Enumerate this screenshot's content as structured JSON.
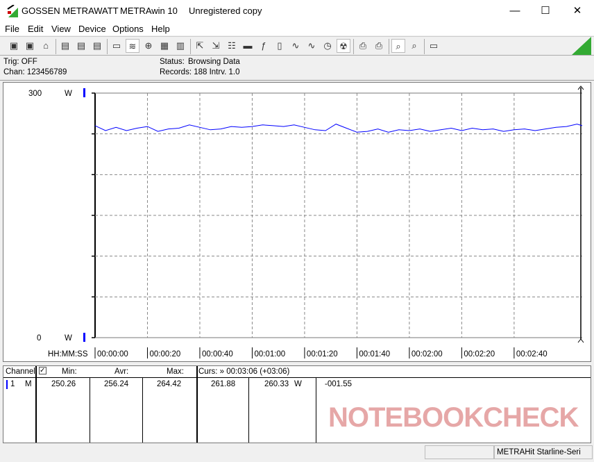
{
  "window": {
    "brand": "GOSSEN METRAWATT",
    "app": "METRAwin 10",
    "license": "Unregistered copy",
    "minimize": "—",
    "maximize": "☐",
    "close": "✕"
  },
  "menu": [
    "File",
    "Edit",
    "View",
    "Device",
    "Options",
    "Help"
  ],
  "toolbar_icons": [
    "save-icon",
    "save-as-icon",
    "open-icon",
    "device-read-icon",
    "device-stop-icon",
    "device-memory-icon",
    "display-icon",
    "wave-view-icon",
    "crosshair-icon",
    "table-icon",
    "histogram-icon",
    "export-icon",
    "import-icon",
    "data-list-icon",
    "monitor-icon",
    "formula-icon",
    "meter-icon",
    "signal-icon",
    "multi-signal-icon",
    "clock-icon",
    "trigger-icon",
    "print-icon",
    "print-setup-icon",
    "zoom-wave-icon",
    "zoom-icon",
    "comment-icon"
  ],
  "info": {
    "trig": "Trig: OFF",
    "chan": "Chan:  123456789",
    "status_label": "Status:",
    "status_value": "Browsing Data",
    "records": "Records: 188  Intrv. 1.0"
  },
  "chart_data": {
    "type": "line",
    "xlabel": "HH:MM:SS",
    "ylabel": "W",
    "ylim": [
      0,
      300
    ],
    "yticks": [
      "300",
      "0"
    ],
    "xlim": [
      0,
      186
    ],
    "xticks": [
      "00:00:00",
      "00:00:20",
      "00:00:40",
      "00:01:00",
      "00:01:20",
      "00:01:40",
      "00:02:00",
      "00:02:20",
      "00:02:40"
    ],
    "grid": true,
    "color": "#0000ff",
    "x": [
      0,
      4,
      8,
      12,
      16,
      20,
      24,
      28,
      32,
      36,
      40,
      44,
      48,
      52,
      56,
      60,
      64,
      68,
      72,
      76,
      80,
      84,
      88,
      92,
      96,
      100,
      104,
      108,
      112,
      116,
      120,
      124,
      128,
      132,
      136,
      140,
      144,
      148,
      152,
      156,
      160,
      164,
      168,
      172,
      176,
      180,
      184,
      186
    ],
    "values": [
      260,
      254,
      258,
      254,
      257,
      259,
      253,
      256,
      257,
      261,
      258,
      255,
      256,
      259,
      258,
      259,
      261,
      260,
      259,
      261,
      258,
      255,
      254,
      262,
      257,
      252,
      253,
      256,
      252,
      255,
      254,
      256,
      253,
      255,
      257,
      254,
      257,
      255,
      256,
      253,
      255,
      256,
      254,
      256,
      258,
      259,
      262,
      260
    ]
  },
  "cursor": {
    "label": "Curs: » 00:03:06 (+03:06)"
  },
  "table": {
    "headers": {
      "channel": "Channel:",
      "min": "Min:",
      "avr": "Avr:",
      "max": "Max:"
    },
    "row": {
      "num": "1",
      "mode": "M",
      "min": "250.26",
      "avr": "256.24",
      "max": "264.42",
      "cur1": "261.88",
      "cur2": "260.33",
      "unit": "W",
      "delta": "-001.55"
    }
  },
  "watermark": "NOTEBOOKCHECK",
  "statusbar": {
    "device": "METRAHit Starline-Seri"
  }
}
